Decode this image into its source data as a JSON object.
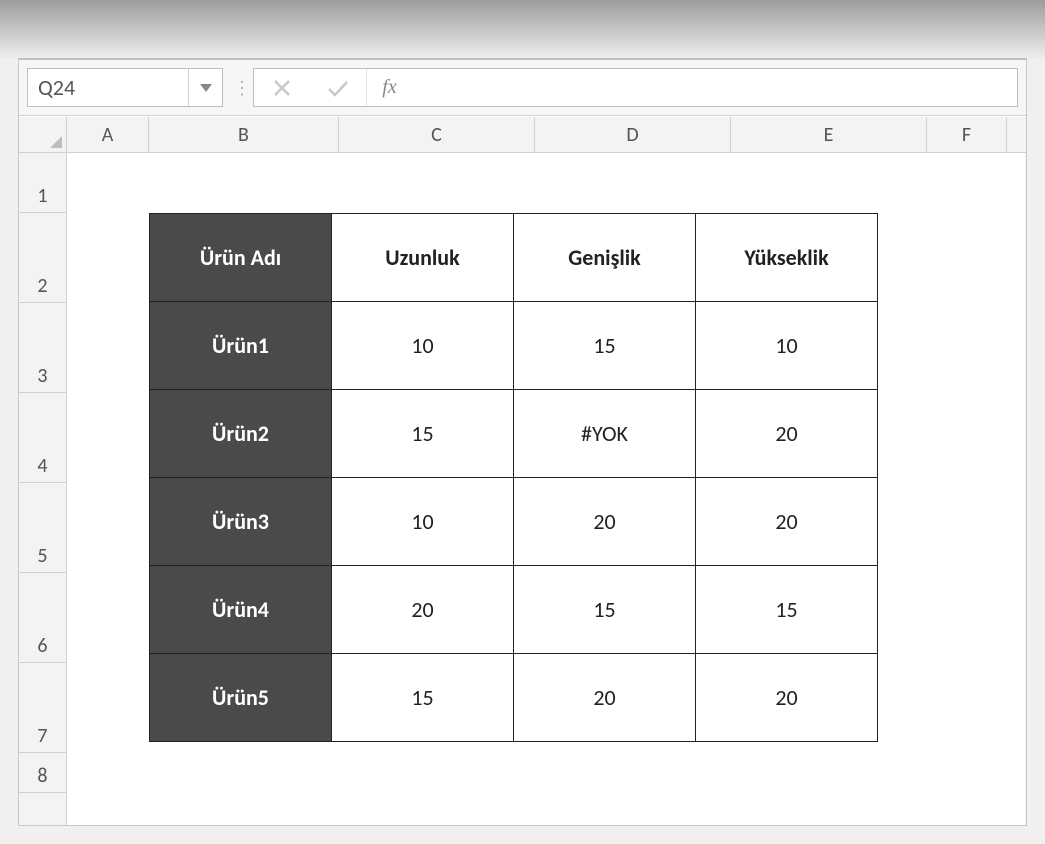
{
  "namebox": {
    "value": "Q24"
  },
  "formula_bar": {
    "fx_label": "fx",
    "value": ""
  },
  "columns": [
    "A",
    "B",
    "C",
    "D",
    "E",
    "F"
  ],
  "rows": [
    "1",
    "2",
    "3",
    "4",
    "5",
    "6",
    "7",
    "8"
  ],
  "table": {
    "headers": [
      "Ürün Adı",
      "Uzunluk",
      "Genişlik",
      "Yükseklik"
    ],
    "row_labels": [
      "Ürün1",
      "Ürün2",
      "Ürün3",
      "Ürün4",
      "Ürün5"
    ],
    "data": [
      [
        "10",
        "15",
        "10"
      ],
      [
        "15",
        "#YOK",
        "20"
      ],
      [
        "10",
        "20",
        "20"
      ],
      [
        "20",
        "15",
        "15"
      ],
      [
        "15",
        "20",
        "20"
      ]
    ]
  }
}
